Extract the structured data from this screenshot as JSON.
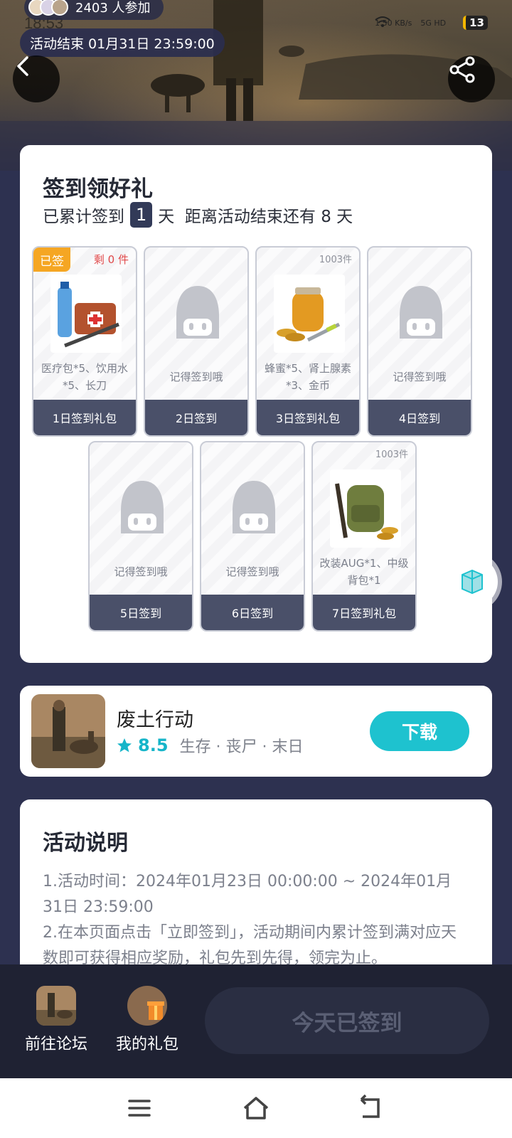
{
  "status_bar": {
    "time": "18:53",
    "network_speed": "1.50 KB/s",
    "signal": "5G HD",
    "battery": "13"
  },
  "header": {
    "participants_text": "2403 人参加",
    "end_time_text": "活动结束 01月31日 23:59:00"
  },
  "signin": {
    "title": "签到领好礼",
    "sub_prefix": "已累计签到",
    "days": "1",
    "sub_mid": "天  距离活动结束还有 8 天",
    "gifts": [
      {
        "label": "1日签到礼包",
        "desc": "医疗包*5、饮用水*5、长刀",
        "badge": "已签",
        "stock": "剩 0 件"
      },
      {
        "label": "2日签到",
        "desc": "记得签到哦"
      },
      {
        "label": "3日签到礼包",
        "desc": "蜂蜜*5、肾上腺素*3、金币",
        "stock": "1003件"
      },
      {
        "label": "4日签到",
        "desc": "记得签到哦"
      },
      {
        "label": "5日签到",
        "desc": "记得签到哦"
      },
      {
        "label": "6日签到",
        "desc": "记得签到哦"
      },
      {
        "label": "7日签到礼包",
        "desc": "改装AUG*1、中级背包*1",
        "stock": "1003件"
      }
    ]
  },
  "game": {
    "name": "废土行动",
    "rating": "8.5",
    "tags": "生存 · 丧尸 · 末日",
    "download_label": "下载"
  },
  "info": {
    "title": "活动说明",
    "text": "1.活动时间：2024年01月23日 00:00:00 ~ 2024年01月31日 23:59:00\n2.在本页面点击「立即签到」，活动期间内累计签到满对应天数即可获得相应奖励，礼包先到先得，领完为止。"
  },
  "bottom": {
    "forum_label": "前往论坛",
    "mygift_label": "我的礼包",
    "checked_label": "今天已签到"
  },
  "colors": {
    "accent": "#1ec2cf",
    "badge": "#f5a623",
    "label_bg": "#4a5069",
    "stock_red": "#e0494a"
  }
}
